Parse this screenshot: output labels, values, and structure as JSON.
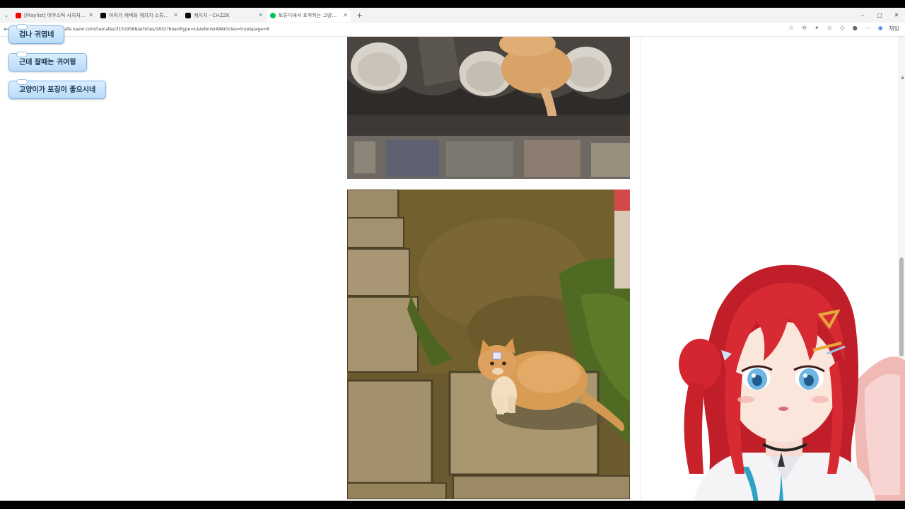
{
  "browser": {
    "tabs": [
      {
        "title": "[Playlist] 어쿠스틱 사자처럼 한 번",
        "favicon_color": "#ff0000",
        "active": false
      },
      {
        "title": "아카가 캐벼와 캐지치 스튜디오",
        "favicon_color": "#0b0b0b",
        "active": false
      },
      {
        "title": "캐지치 - CHZZK",
        "favicon_color": "#0b0b0b",
        "active": false
      },
      {
        "title": "토튜디에서 포착하는 고양이 네",
        "favicon_color": "#03c75a",
        "active": true
      }
    ],
    "new_tab_label": "+",
    "url": "cafe.naver.com/f-e/cafes/31519588/articles/1832?boardtype=L&referrerAllArticles=true&page=8",
    "profile_label": "채팅"
  },
  "chat_bubbles": [
    {
      "text": "겁나 귀엽네"
    },
    {
      "text": "근데 잘때는 귀여웡"
    },
    {
      "text": "고양이가 포징이 좋으시네"
    }
  ],
  "icons": {
    "back": "back-arrow-icon",
    "star": "bookmark-star-icon",
    "extensions": "extensions-icon",
    "profile": "profile-icon",
    "menu": "more-menu-icon"
  },
  "colors": {
    "bubble_border": "#7fb5e6",
    "bubble_text": "#1b3550",
    "avatar_hair": "#d8282f"
  }
}
